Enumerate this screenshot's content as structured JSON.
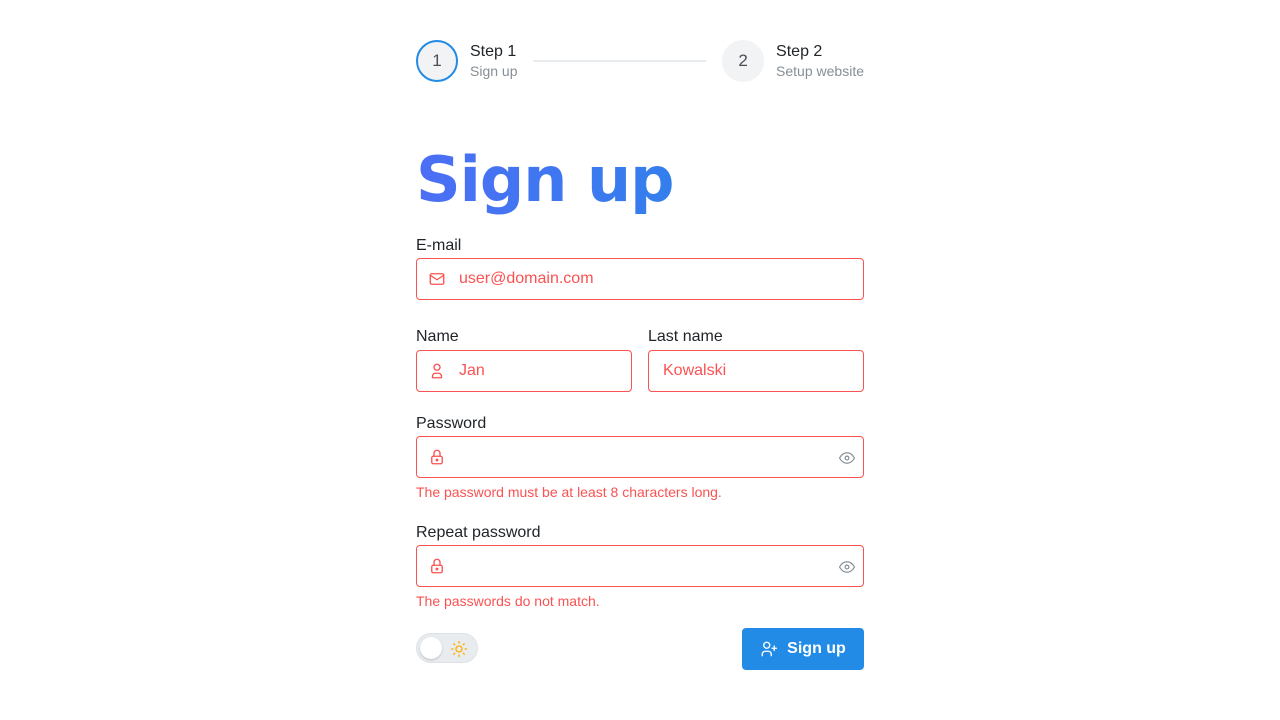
{
  "stepper": {
    "steps": [
      {
        "number": "1",
        "title": "Step 1",
        "description": "Sign up"
      },
      {
        "number": "2",
        "title": "Step 2",
        "description": "Setup website"
      }
    ]
  },
  "title": "Sign up",
  "form": {
    "email": {
      "label": "E-mail",
      "value": "user@domain.com",
      "icon": "mail-icon"
    },
    "name": {
      "label": "Name",
      "value": "Jan",
      "icon": "user-icon"
    },
    "last_name": {
      "label": "Last name",
      "value": "Kowalski"
    },
    "password": {
      "label": "Password",
      "value": "",
      "error": "The password must be at least 8 characters long.",
      "icon": "lock-icon"
    },
    "repeat_password": {
      "label": "Repeat password",
      "value": "",
      "error": "The passwords do not match.",
      "icon": "lock-icon"
    },
    "submit_label": "Sign up"
  },
  "colors": {
    "accent": "#228be6",
    "error": "#fa5252",
    "title_gradient_start": "#4c6ef5",
    "title_gradient_end": "#228be6"
  }
}
